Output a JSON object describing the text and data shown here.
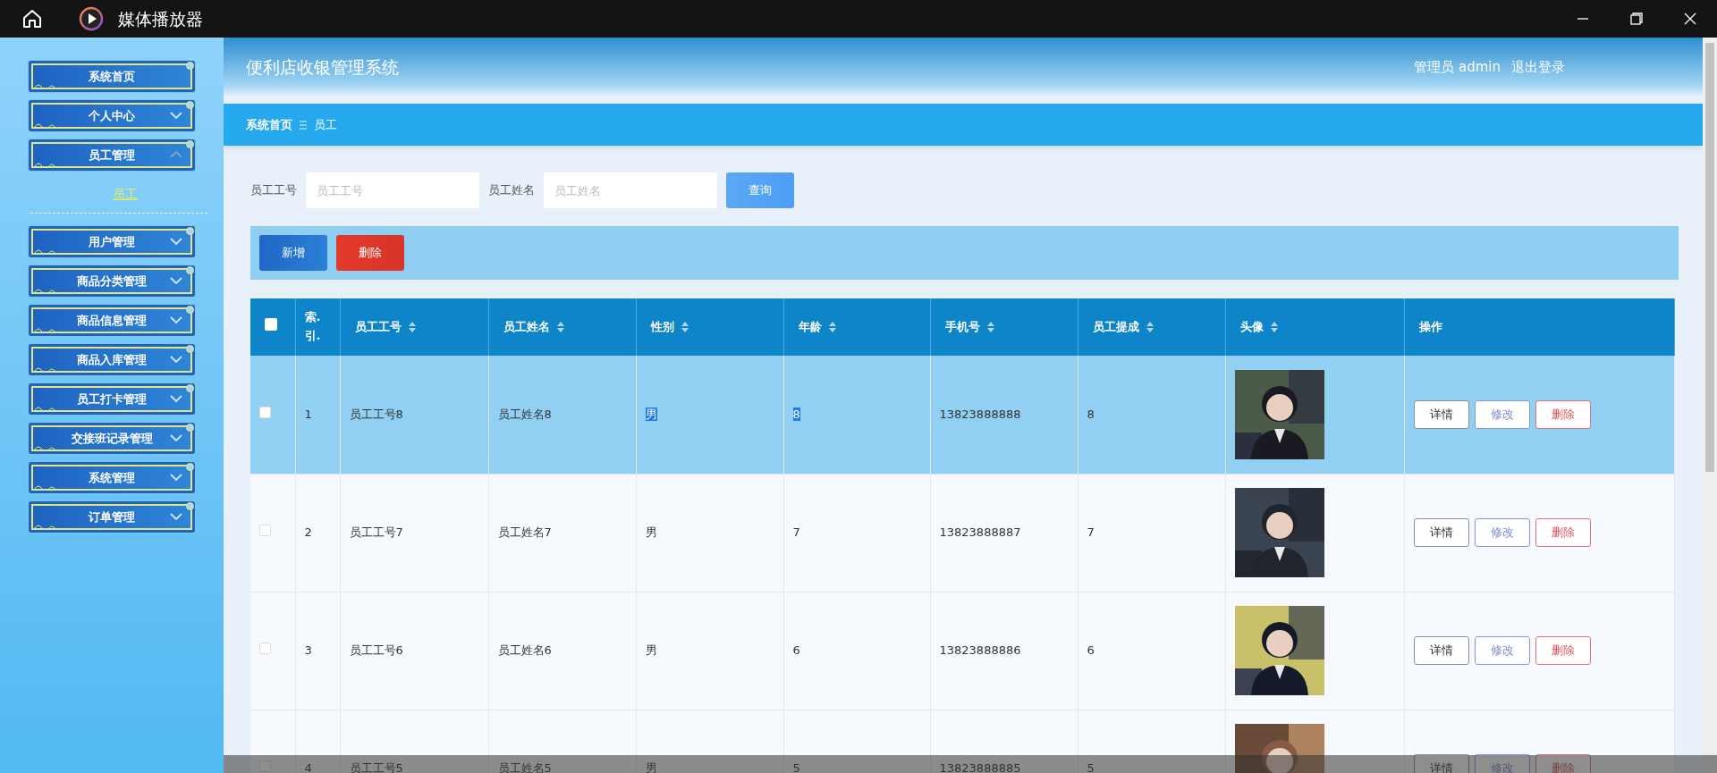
{
  "player": {
    "title": "媒体播放器"
  },
  "app": {
    "title": "便利店收银管理系统",
    "user_label": "管理员 admin",
    "logout": "退出登录"
  },
  "sidebar": {
    "items": [
      {
        "label": "系统首页",
        "kind": "link"
      },
      {
        "label": "个人中心",
        "kind": "menu",
        "expanded": false
      },
      {
        "label": "员工管理",
        "kind": "menu",
        "expanded": true,
        "children": [
          {
            "label": "员工",
            "selected": true
          }
        ]
      },
      {
        "label": "用户管理",
        "kind": "menu",
        "expanded": false
      },
      {
        "label": "商品分类管理",
        "kind": "menu",
        "expanded": false
      },
      {
        "label": "商品信息管理",
        "kind": "menu",
        "expanded": false
      },
      {
        "label": "商品入库管理",
        "kind": "menu",
        "expanded": false
      },
      {
        "label": "员工打卡管理",
        "kind": "menu",
        "expanded": false
      },
      {
        "label": "交接班记录管理",
        "kind": "menu",
        "expanded": false
      },
      {
        "label": "系统管理",
        "kind": "menu",
        "expanded": false
      },
      {
        "label": "订单管理",
        "kind": "menu",
        "expanded": false
      }
    ]
  },
  "breadcrumb": [
    "系统首页",
    "员工"
  ],
  "search": {
    "fields": [
      {
        "label": "员工工号",
        "placeholder": "员工工号"
      },
      {
        "label": "员工姓名",
        "placeholder": "员工姓名"
      }
    ],
    "button": "查询"
  },
  "toolbar": [
    {
      "label": "新增",
      "kind": "primary"
    },
    {
      "label": "删除",
      "kind": "danger"
    }
  ],
  "table": {
    "select_all_checked": false,
    "columns": [
      {
        "label": "索.引.",
        "sortable": false
      },
      {
        "label": "员工工号",
        "sortable": true
      },
      {
        "label": "员工姓名",
        "sortable": true
      },
      {
        "label": "性别",
        "sortable": true
      },
      {
        "label": "年龄",
        "sortable": true
      },
      {
        "label": "手机号",
        "sortable": true
      },
      {
        "label": "员工提成",
        "sortable": true
      },
      {
        "label": "头像",
        "sortable": true
      },
      {
        "label": "操作",
        "sortable": false
      }
    ],
    "rows": [
      {
        "index": "1",
        "id": "员工工号8",
        "name": "员工姓名8",
        "gender": "男",
        "age": "8",
        "phone": "13823888888",
        "commission": "8",
        "selected": true,
        "checked": false,
        "text_selected": true,
        "actions": [
          "详情",
          "修改",
          "删除"
        ]
      },
      {
        "index": "2",
        "id": "员工工号7",
        "name": "员工姓名7",
        "gender": "男",
        "age": "7",
        "phone": "13823888887",
        "commission": "7",
        "selected": false,
        "checked": false,
        "text_selected": false,
        "actions": [
          "详情",
          "修改",
          "删除"
        ]
      },
      {
        "index": "3",
        "id": "员工工号6",
        "name": "员工姓名6",
        "gender": "男",
        "age": "6",
        "phone": "13823888886",
        "commission": "6",
        "selected": false,
        "checked": false,
        "text_selected": false,
        "actions": [
          "详情",
          "修改",
          "删除"
        ]
      },
      {
        "index": "4",
        "id": "员工工号5",
        "name": "员工姓名5",
        "gender": "男",
        "age": "5",
        "phone": "13823888885",
        "commission": "5",
        "selected": false,
        "checked": false,
        "text_selected": false,
        "actions": [
          "详情",
          "修改",
          "删除"
        ]
      }
    ]
  }
}
